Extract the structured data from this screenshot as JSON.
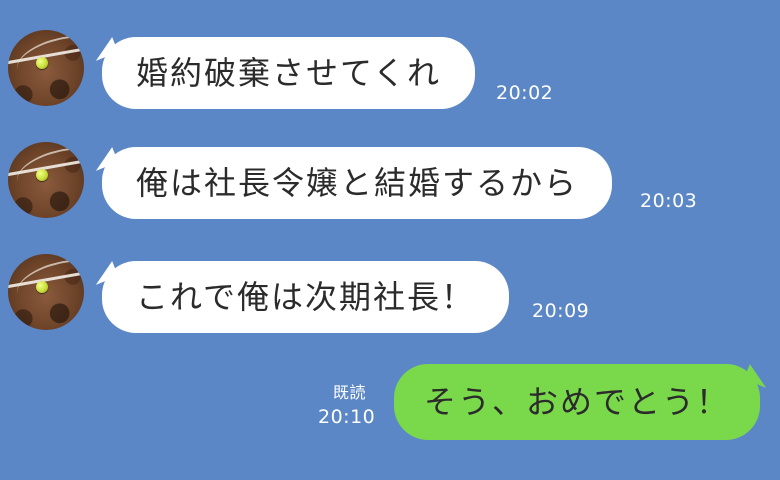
{
  "messages": [
    {
      "direction": "incoming",
      "text": "婚約破棄させてくれ",
      "time": "20:02"
    },
    {
      "direction": "incoming",
      "text": "俺は社長令嬢と結婚するから",
      "time": "20:03"
    },
    {
      "direction": "incoming",
      "text": "これで俺は次期社長！",
      "time": "20:09"
    },
    {
      "direction": "outgoing",
      "text": "そう、おめでとう！",
      "time": "20:10",
      "read_label": "既読"
    }
  ],
  "colors": {
    "background": "#5b87c7",
    "incoming_bubble": "#ffffff",
    "outgoing_bubble": "#7ad84b",
    "meta_text": "#ffffff"
  }
}
